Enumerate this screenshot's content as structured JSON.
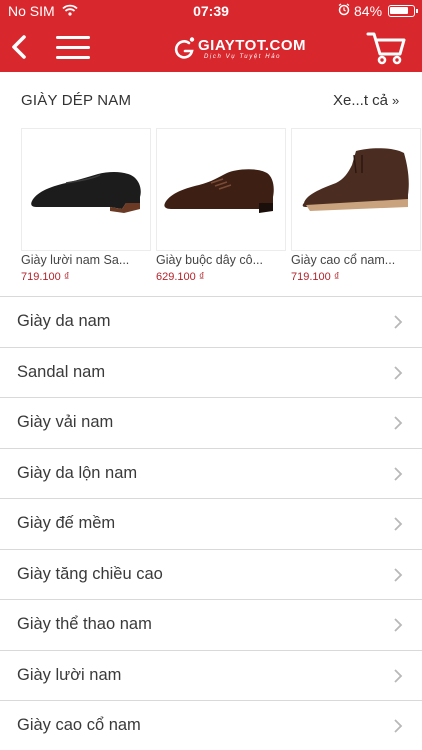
{
  "status_bar": {
    "carrier": "No SIM",
    "time": "07:39",
    "battery_percent": "84%",
    "battery_level": 0.84
  },
  "header": {
    "brand": "GIAYTOT.COM",
    "tagline": "Dịch Vụ Tuyệt Hảo",
    "accent_color": "#d9272e"
  },
  "section": {
    "title": "GIÀY DÉP NAM",
    "see_all": "Xe...t cả",
    "see_all_chevron": "»"
  },
  "products": [
    {
      "name": "Giày lười nam Sa...",
      "price": "719.100 ₫"
    },
    {
      "name": "Giày buộc dây cô...",
      "price": "629.100 ₫"
    },
    {
      "name": "Giày cao cổ nam...",
      "price": "719.100 ₫"
    }
  ],
  "categories": [
    "Giày da nam",
    "Sandal nam",
    "Giày vải nam",
    "Giày da lộn nam",
    "Giày đế mềm",
    "Giày tăng chiều cao",
    "Giày thể thao nam",
    "Giày lười nam",
    "Giày cao cổ nam"
  ]
}
